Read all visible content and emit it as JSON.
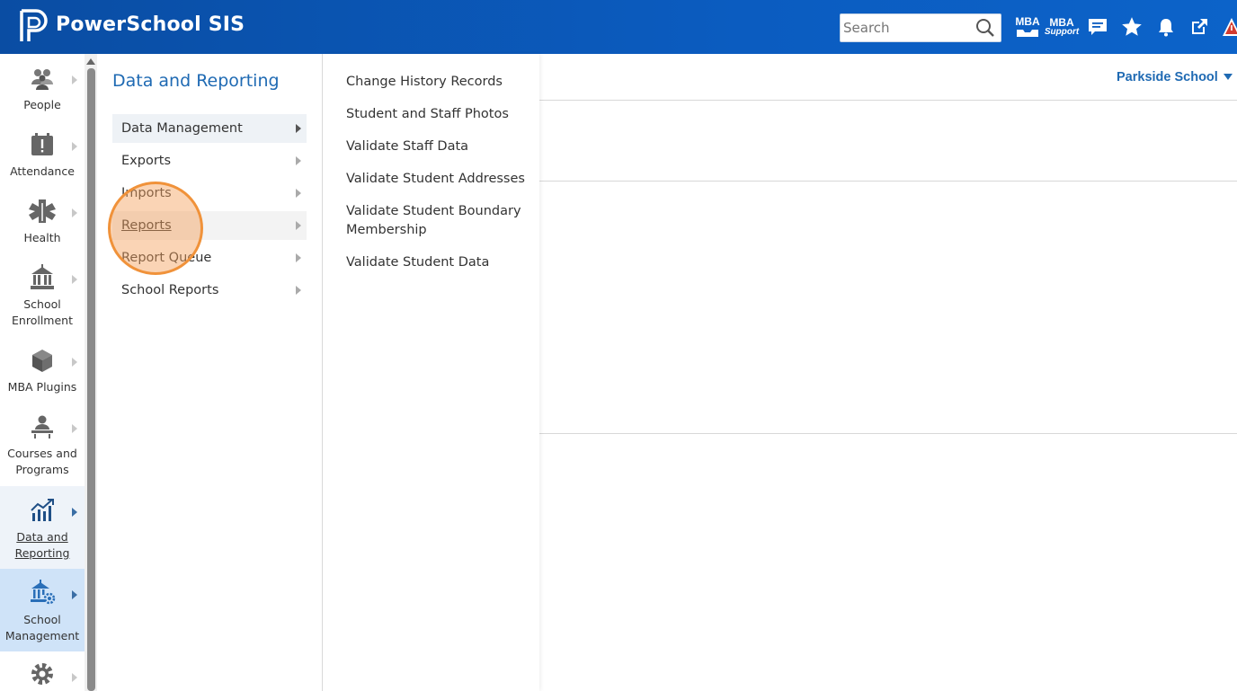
{
  "header": {
    "brand": "PowerSchool SIS",
    "search_placeholder": "Search",
    "mba_label": "MBA",
    "mba_support_top": "MBA",
    "mba_support_bottom": "Support",
    "icons": [
      "mba-inbox-icon",
      "mba-support-icon",
      "chat-icon",
      "star-icon",
      "bell-icon",
      "external-link-icon",
      "alert-icon"
    ]
  },
  "leftnav": {
    "items": [
      {
        "label": "People",
        "icon": "people-icon"
      },
      {
        "label": "Attendance",
        "icon": "attendance-icon"
      },
      {
        "label": "Health",
        "icon": "health-icon"
      },
      {
        "label": "School Enrollment",
        "icon": "school-enrollment-icon"
      },
      {
        "label": "MBA Plugins",
        "icon": "cube-icon"
      },
      {
        "label": "Courses and Programs",
        "icon": "courses-icon"
      },
      {
        "label": "Data and Reporting",
        "icon": "chart-icon"
      },
      {
        "label": "School Management",
        "icon": "school-management-icon"
      },
      {
        "label": "",
        "icon": "gear-icon"
      }
    ]
  },
  "panel1": {
    "title": "Data and Reporting",
    "items": [
      "Data Management",
      "Exports",
      "Imports",
      "Reports",
      "Report Queue",
      "School Reports"
    ]
  },
  "panel2": {
    "items": [
      "Change History Records",
      "Student and Staff Photos",
      "Validate Staff Data",
      "Validate Student Addresses",
      "Validate Student Boundary Membership",
      "Validate Student Data"
    ]
  },
  "main": {
    "school": "Parkside School"
  },
  "colors": {
    "header_blue": "#0b5cc0",
    "accent_blue": "#1f6ab3",
    "click_highlight": "#f0923a"
  }
}
